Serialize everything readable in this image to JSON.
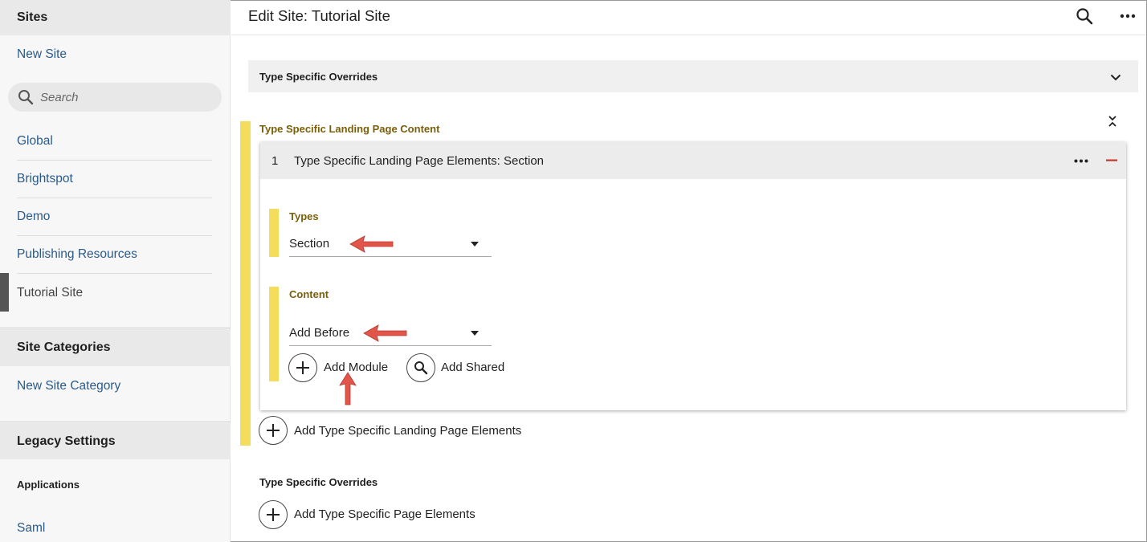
{
  "sidebar": {
    "sites_header": "Sites",
    "new_site": "New Site",
    "search_placeholder": "Search",
    "sites": [
      "Global",
      "Brightspot",
      "Demo",
      "Publishing Resources",
      "Tutorial Site"
    ],
    "site_categories_header": "Site Categories",
    "new_site_category": "New Site Category",
    "legacy_header": "Legacy Settings",
    "applications_label": "Applications",
    "saml": "Saml"
  },
  "header": {
    "title": "Edit Site: Tutorial Site",
    "search_icon": "search-icon",
    "more_icon": "more-horizontal-icon"
  },
  "main": {
    "overrides_bar_label": "Type Specific Overrides",
    "landing_content_label": "Type Specific Landing Page Content",
    "card": {
      "index": "1",
      "title": "Type Specific Landing Page Elements: Section",
      "types_label": "Types",
      "types_value": "Section",
      "content_label": "Content",
      "content_value": "Add Before",
      "add_module": "Add Module",
      "add_shared": "Add Shared"
    },
    "add_landing_elements": "Add Type Specific Landing Page Elements",
    "overrides_label": "Type Specific Overrides",
    "add_page_elements": "Add Type Specific Page Elements"
  },
  "colors": {
    "accent_yellow": "#f5dd5c",
    "gold_label": "#7a5f0a",
    "link_blue": "#2a5a8a",
    "annotation_red": "#e2554a",
    "remove_red": "#c0392b"
  }
}
